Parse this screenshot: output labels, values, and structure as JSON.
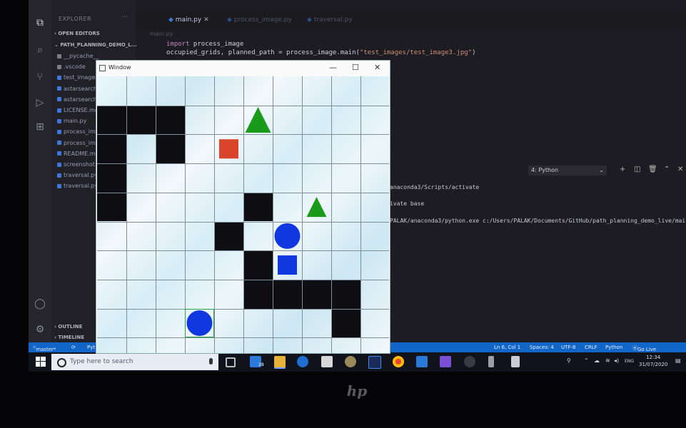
{
  "explorer": {
    "title": "EXPLORER",
    "more": "···",
    "open_editors": "OPEN EDITORS",
    "project": "PATH_PLANNING_DEMO_L...",
    "files": [
      {
        "name": "__pycache__",
        "color": "#7c7c86"
      },
      {
        "name": ".vscode",
        "color": "#7c7c86"
      },
      {
        "name": "test_images",
        "color": "#3c78d8"
      },
      {
        "name": "astarsearch.py",
        "color": "#3c78d8"
      },
      {
        "name": "astarsearch.pyc",
        "color": "#3c78d8"
      },
      {
        "name": "LICENSE.md",
        "color": "#3c78d8"
      },
      {
        "name": "main.py",
        "color": "#3c78d8"
      },
      {
        "name": "process_image.py",
        "color": "#3c78d8"
      },
      {
        "name": "process_image.pyc",
        "color": "#3c78d8"
      },
      {
        "name": "README.md",
        "color": "#3c78d8"
      },
      {
        "name": "screenshot.png",
        "color": "#3c78d8"
      },
      {
        "name": "traversal.py",
        "color": "#3c78d8"
      },
      {
        "name": "traversal.pyc",
        "color": "#3c78d8"
      }
    ],
    "outline": "OUTLINE",
    "timeline": "TIMELINE"
  },
  "tabs": [
    {
      "label": "main.py",
      "active": true
    },
    {
      "label": "process_image.py",
      "active": false
    },
    {
      "label": "traversal.py",
      "active": false
    }
  ],
  "breadcrumb": "main.py",
  "code": {
    "line1_kw": "import",
    "line1_rest": " process_image",
    "line2_a": "occupied_grids, planned_path = process_image.main(",
    "line2_str": "\"test_images/test_image3.jpg\"",
    "line2_b": ")"
  },
  "terminal": {
    "selector": "4: Python",
    "lines": [
      "anaconda3/Scripts/activate",
      "ivate base",
      "PALAK/anaconda3/python.exe c:/Users/PALAK/Documents/GitHub/path_planning_demo_live/mai"
    ]
  },
  "status": {
    "branch": "master*",
    "lang_left": "Pyt",
    "position": "Ln 6, Col 1",
    "spaces": "Spaces: 4",
    "encoding": "UTF-8",
    "eol": "CRLF",
    "language": "Python",
    "golive": "Go Live"
  },
  "window": {
    "title": "Window",
    "minimize": "—",
    "maximize": "☐",
    "close": "✕",
    "grid_cols": 10,
    "grid_rows": 10,
    "black_cells": [
      [
        0,
        1
      ],
      [
        1,
        1
      ],
      [
        2,
        1
      ],
      [
        0,
        2
      ],
      [
        2,
        2
      ],
      [
        0,
        3
      ],
      [
        0,
        4
      ],
      [
        5,
        4
      ],
      [
        4,
        5
      ],
      [
        5,
        6
      ],
      [
        5,
        7
      ],
      [
        6,
        7
      ],
      [
        7,
        7
      ],
      [
        8,
        7
      ],
      [
        8,
        8
      ]
    ],
    "shapes": [
      {
        "type": "triangle",
        "color": "#1a9a1a",
        "col": 5,
        "row": 1,
        "size": "large"
      },
      {
        "type": "square",
        "color": "#d8452a",
        "col": 4,
        "row": 2,
        "size": "medium"
      },
      {
        "type": "triangle",
        "color": "#1a9a1a",
        "col": 7,
        "row": 4,
        "size": "small"
      },
      {
        "type": "circle",
        "color": "#1038e0",
        "col": 6,
        "row": 5,
        "size": "large"
      },
      {
        "type": "square",
        "color": "#1038e0",
        "col": 6,
        "row": 6,
        "size": "medium"
      },
      {
        "type": "circle",
        "color": "#1038e0",
        "col": 3,
        "row": 8,
        "size": "large"
      }
    ],
    "highlight_cell": [
      3,
      8
    ]
  },
  "taskbar": {
    "search_placeholder": "Type here to search",
    "mail_badge": "28",
    "lang": "ENG",
    "time": "12:34",
    "date": "31/07/2020"
  },
  "laptop_brand": "hp"
}
